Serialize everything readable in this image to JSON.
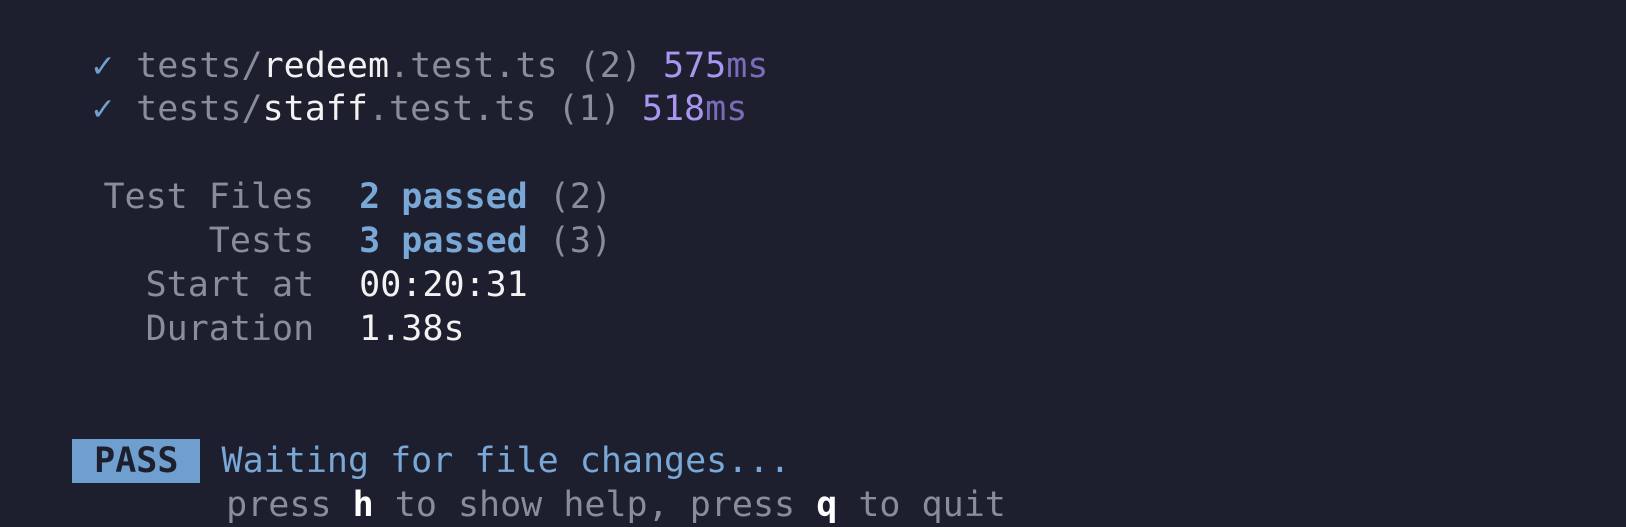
{
  "terminal": {
    "test_lines": [
      {
        "check": "✓",
        "prefix": "tests/",
        "name": "redeem",
        "suffix": ".test.ts",
        "count": "(2)",
        "time_value": "575",
        "time_unit": "ms"
      },
      {
        "check": "✓",
        "prefix": "tests/",
        "name": "staff",
        "suffix": ".test.ts",
        "count": "(1)",
        "time_value": "518",
        "time_unit": "ms"
      }
    ],
    "summary": {
      "test_files_label": "Test Files",
      "test_files_passed": "2 passed",
      "test_files_total": "(2)",
      "tests_label": "Tests",
      "tests_passed": "3 passed",
      "tests_total": "(3)",
      "start_label": "Start at",
      "start_value": "00:20:31",
      "duration_label": "Duration",
      "duration_value": "1.38s"
    },
    "status": {
      "badge": "PASS",
      "waiting_text": "Waiting for file changes...",
      "hint_press_1": "press ",
      "hint_key_1": "h",
      "hint_mid": " to show help, press ",
      "hint_key_2": "q",
      "hint_end": " to quit"
    },
    "colors": {
      "background": "#1e1f2e",
      "accent_blue": "#79a7d6",
      "accent_purple": "#a896f0",
      "dim_text": "#8a8c99"
    }
  }
}
